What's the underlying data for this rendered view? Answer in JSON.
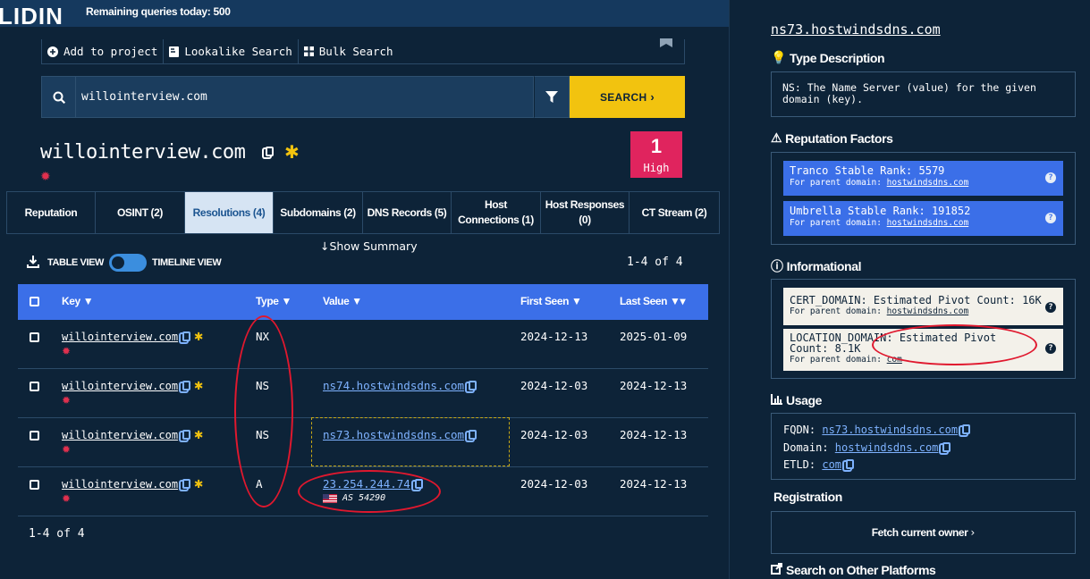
{
  "header": {
    "logo": "LIDIN",
    "quota": "Remaining queries today: 500"
  },
  "toolbar": {
    "add": "Add to project",
    "lookalike": "Lookalike Search",
    "bulk": "Bulk Search"
  },
  "search": {
    "value": "willointerview.com",
    "button": "SEARCH"
  },
  "domain": {
    "name": "willointerview.com",
    "risk_score": "1",
    "risk_label": "High"
  },
  "tabs": [
    "Reputation",
    "OSINT (2)",
    "Resolutions (4)",
    "Subdomains (2)",
    "DNS Records (5)",
    "Host Connections (1)",
    "Host Responses (0)",
    "CT Stream (2)"
  ],
  "summary": {
    "show": "Show Summary"
  },
  "views": {
    "table": "TABLE VIEW",
    "timeline": "TIMELINE VIEW",
    "count": "1-4 of 4"
  },
  "table": {
    "headers": {
      "key": "Key",
      "type": "Type",
      "value": "Value",
      "first": "First Seen",
      "last": "Last Seen"
    },
    "rows": [
      {
        "key": "willointerview.com",
        "type": "NX",
        "value": "",
        "first": "2024-12-13",
        "last": "2025-01-09"
      },
      {
        "key": "willointerview.com",
        "type": "NS",
        "value": "ns74.hostwindsdns.com",
        "first": "2024-12-03",
        "last": "2024-12-13"
      },
      {
        "key": "willointerview.com",
        "type": "NS",
        "value": "ns73.hostwindsdns.com",
        "first": "2024-12-03",
        "last": "2024-12-13"
      },
      {
        "key": "willointerview.com",
        "type": "A",
        "value": "23.254.244.74",
        "asn": "AS 54290",
        "first": "2024-12-03",
        "last": "2024-12-13"
      }
    ],
    "footer": "1-4 of 4"
  },
  "panel": {
    "title": "ns73.hostwindsdns.com",
    "type_desc_head": "Type Description",
    "type_desc": "NS: The Name Server (value) for the given domain (key).",
    "rep_head": "Reputation Factors",
    "rep": [
      {
        "label": "Tranco Stable Rank: 5579",
        "sub": "For parent domain: ",
        "link": "hostwindsdns.com"
      },
      {
        "label": "Umbrella Stable Rank: 191852",
        "sub": "For parent domain: ",
        "link": "hostwindsdns.com"
      }
    ],
    "info_head": "Informational",
    "info": [
      {
        "label": "CERT_DOMAIN: Estimated Pivot Count: 16K",
        "sub": "For parent domain: ",
        "link": "hostwindsdns.com"
      },
      {
        "label": "LOCATION_DOMAIN: Estimated Pivot Count: 8.1K",
        "sub": "For parent domain: ",
        "link": "com"
      }
    ],
    "usage_head": "Usage",
    "usage": {
      "fqdn_label": "FQDN: ",
      "fqdn": "ns73.hostwindsdns.com",
      "domain_label": "Domain: ",
      "domain": "hostwindsdns.com",
      "etld_label": "ETLD: ",
      "etld": "com"
    },
    "reg_head": "Registration",
    "fetch": "Fetch current owner",
    "other_head": "Search on Other Platforms"
  }
}
